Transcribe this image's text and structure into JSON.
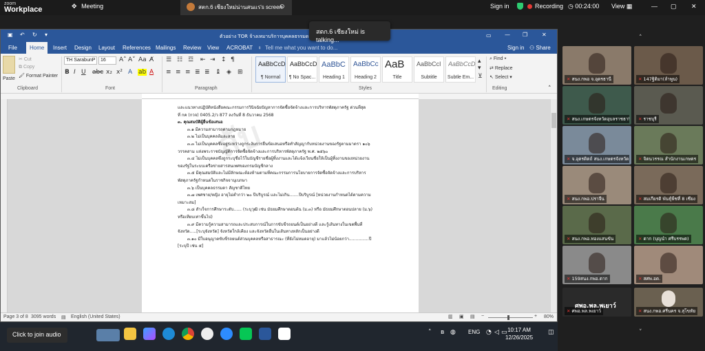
{
  "zoom": {
    "brand_top": "zoom",
    "brand_bottom": "Workplace",
    "meeting_tab": "Meeting",
    "share_tab": "สตก.6 เชียงใหม่น่านสนแร's screen",
    "sign_in": "Sign in",
    "recording": "Recording",
    "timer": "00:24:00",
    "view": "View",
    "talking": "สตก.6 เชียงใหม่ is talking..."
  },
  "word": {
    "title": "ตัวอย่าง TOR จ้างเหมาบริการบุคคลธรรมดา(ร... - Word",
    "tabs": [
      "File",
      "Home",
      "Insert",
      "Design",
      "Layout",
      "References",
      "Mailings",
      "Review",
      "View",
      "ACROBAT"
    ],
    "tell_me": "Tell me what you want to do...",
    "sign_in": "Sign in",
    "share": "Share",
    "clipboard": {
      "paste": "Paste",
      "cut": "Cut",
      "copy": "Copy",
      "format_painter": "Format Painter",
      "label": "Clipboard"
    },
    "font": {
      "name": "TH SarabunP",
      "size": "16",
      "label": "Font"
    },
    "paragraph_label": "Paragraph",
    "styles_label": "Styles",
    "styles": [
      {
        "sample": "AaBbCcDı",
        "name": "¶ Normal"
      },
      {
        "sample": "AaBbCcDı",
        "name": "¶ No Spac..."
      },
      {
        "sample": "AaBbC",
        "name": "Heading 1"
      },
      {
        "sample": "AaBbCc",
        "name": "Heading 2"
      },
      {
        "sample": "AaB",
        "name": "Title"
      },
      {
        "sample": "AaBbCcI",
        "name": "Subtitle"
      },
      {
        "sample": "AaBbCcDı",
        "name": "Subtle Em..."
      }
    ],
    "editing": {
      "find": "Find",
      "replace": "Replace",
      "select": "Select",
      "label": "Editing"
    },
    "doc_lines": [
      {
        "t": "และแนวทางปฏิบัติหนังสือคณะกรรมการวินิจฉัยปัญหาการจัดซื้อจัดจ้างและการบริหารพัสดุภาครัฐ ด่วนที่สุด",
        "c": ""
      },
      {
        "t": "ที่ กค (กวจ) 0405.2/ว 877 ลงวันที่ 8 ธันวาคม 2568",
        "c": ""
      },
      {
        "t": "๓. คุณสมบัติผู้ยื่นข้อเสนอ",
        "c": "h"
      },
      {
        "t": "๓.๑ มีความสามารถตามกฎหมาย",
        "c": "ind"
      },
      {
        "t": "๓.๒ ไม่เป็นบุคคลล้มละลาย",
        "c": "ind"
      },
      {
        "t": "๓.๓ ไม่เป็นบุคคลซึ่งอยู่ระหว่างถูกระงับการยื่นข้อเสนอหรือทำสัญญากับหน่วยงานของรัฐตามมาตรา ๑๐๖",
        "c": "ind"
      },
      {
        "t": "วรรคสาม แห่งพระราชบัญญัติการจัดซื้อจัดจ้างและการบริหารพัสดุภาครัฐ พ.ศ. ๒๕๖๐",
        "c": ""
      },
      {
        "t": "๓.๔ ไม่เป็นบุคคลซึ่งถูกระบุชื่อไว้ในบัญชีรายชื่อผู้ทิ้งงานและได้แจ้งเวียนชื่อให้เป็นผู้ทิ้งงานของหน่วยงาน",
        "c": "ind"
      },
      {
        "t": "ของรัฐในระบบเครือข่ายสารสนเทศของกรมบัญชีกลาง",
        "c": ""
      },
      {
        "t": "๓.๕ มีคุณสมบัติและไม่มีลักษณะต้องห้ามตามที่คณะกรรมการนโยบายการจัดซื้อจัดจ้างและการบริหาร",
        "c": "ind"
      },
      {
        "t": "พัสดุภาครัฐกำหนดในราชกิจจานุเบกษา",
        "c": ""
      },
      {
        "t": "๓.๖ เป็นบุคคลธรรมดา สัญชาติไทย",
        "c": "ind"
      },
      {
        "t": "๓.๗ เพศชาย/หญิง อายุไม่ต่ำกว่า ๒๐ ปีบริบูรณ์ และไม่เกิน.......ปีบริบูรณ์ [หน่วยงานกำหนดได้ตามความ",
        "c": "ind"
      },
      {
        "t": "เหมาะสม]",
        "c": ""
      },
      {
        "t": "๓.๘ สำเร็จการศึกษาระดับ...... (ระบุวุฒิ เช่น มัธยมศึกษาตอนต้น (ม.๓) หรือ มัธยมศึกษาตอนปลาย (ม.๖)",
        "c": "ind"
      },
      {
        "t": "หรือเทียบเท่าขึ้นไป)",
        "c": ""
      },
      {
        "t": "๓.๙ มีความรู้ความสามารถและประสบการณ์ในการขับขี่รถยนต์เป็นอย่างดี และรู้เส้นทางในเขตพื้นที่",
        "c": "ind"
      },
      {
        "t": "จังหวัด.....[ระบุจังหวัด] จังหวัดใกล้เคียง และจังหวัดอื่นในเส้นทางหลักเป็นอย่างดี",
        "c": ""
      },
      {
        "t": "๓.๑๐ มีใบอนุญาตขับขี่รถยนต์ส่วนบุคคลหรือสาธารณะ (ที่ยังไม่หมดอายุ) มาแล้วไม่น้อยกว่า...............ปี",
        "c": "ind"
      },
      {
        "t": "[ระบุปี เช่น ๕]",
        "c": ""
      }
    ],
    "status": {
      "page": "Page 3 of 8",
      "words": "3095 words",
      "language": "English (United States)",
      "zoom": "80%"
    }
  },
  "taskbar": {
    "time": "10:17 AM",
    "date": "12/26/2025",
    "lang": "ENG"
  },
  "join_audio": "Click to join audio",
  "participants": [
    {
      "name": "สนง.กพอ จ.อุดรธานี",
      "color": "#8a7a6a"
    },
    {
      "name": "147ฐิติมา(ลำพูน)",
      "color": "#6b5a4a"
    },
    {
      "name": "สนง.เกษตรจังหวัดอุบลราชธานี",
      "color": "#3e5a4c"
    },
    {
      "name": "ราชบุรี",
      "color": "#5a5a50"
    },
    {
      "name": "จ.อุตรดิตถ์ สนง.เกษตรจังหวัด",
      "color": "#7a8a9a"
    },
    {
      "name": "จิตนวรรณ สำนักงานเกษตร",
      "color": "#6a7a5a"
    },
    {
      "name": "สนง.กพอ.ปราจีน",
      "color": "#9a8a7a"
    },
    {
      "name": "สมเกียรติ พันธุ์พืชที่ 8 เชียง",
      "color": "#7a6a5a"
    },
    {
      "name": "สนง.กพอ.ทองแสนขัน",
      "color": "#5a6a4a"
    },
    {
      "name": "ตาก (บุญนำ ศรีบรรพต)",
      "color": "#4a7a4a"
    },
    {
      "name": "159สนง.กพอ.ตาก",
      "color": "#8a8a8a"
    },
    {
      "name": "สศพ.อด.",
      "color": "#a08a7a"
    }
  ],
  "bottom_participants": [
    {
      "name": "ศพอ.พล.พเยาว์",
      "color": "#2a2a2a"
    },
    {
      "name": "สนง.กพอ.ศรีนคร จ.สุโขทัย",
      "color": "#6a6050"
    }
  ],
  "big_name": "ศพอ.พล.พเยาว์"
}
